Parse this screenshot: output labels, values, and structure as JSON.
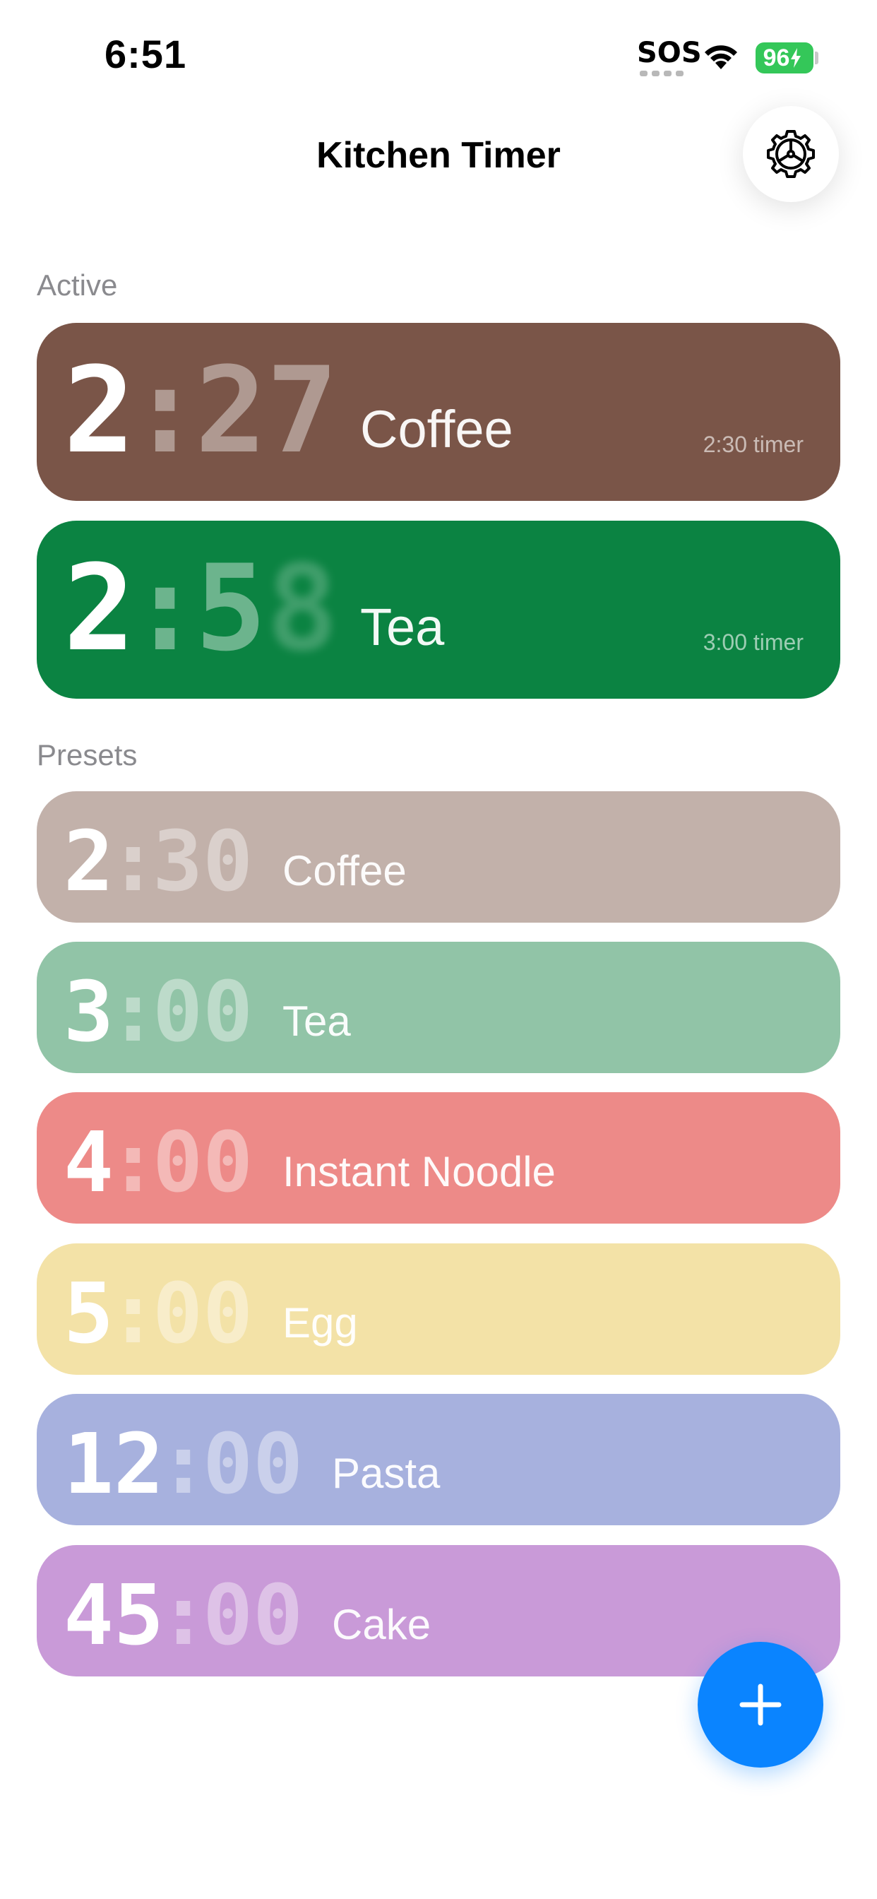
{
  "status_bar": {
    "time": "6:51",
    "sos": "SOS",
    "battery": "96"
  },
  "header": {
    "title": "Kitchen Timer"
  },
  "sections": {
    "active_label": "Active",
    "presets_label": "Presets"
  },
  "active": [
    {
      "minutes": "2",
      "seconds": "27",
      "name": "Coffee",
      "subtitle": "2:30 timer",
      "color": "#7a5548"
    },
    {
      "minutes": "2",
      "seconds_main": "5",
      "seconds_blur": "8",
      "name": "Tea",
      "subtitle": "3:00 timer",
      "color": "#0b8342"
    }
  ],
  "presets": [
    {
      "minutes": "2",
      "seconds": "30",
      "name": "Coffee",
      "color": "#c2b1aa"
    },
    {
      "minutes": "3",
      "seconds": "00",
      "name": "Tea",
      "color": "#91c4a7"
    },
    {
      "minutes": "4",
      "seconds": "00",
      "name": "Instant Noodle",
      "color": "#ed8a88"
    },
    {
      "minutes": "5",
      "seconds": "00",
      "name": "Egg",
      "color": "#f3e2a7"
    },
    {
      "minutes": "12",
      "seconds": "00",
      "name": "Pasta",
      "color": "#a7b1de"
    },
    {
      "minutes": "45",
      "seconds": "00",
      "name": "Cake",
      "color": "#c99ad8"
    }
  ],
  "icons": {
    "settings": "gear-icon",
    "add": "plus-icon",
    "wifi": "wifi-icon"
  },
  "colors": {
    "accent": "#0a84ff",
    "battery": "#34c759"
  }
}
